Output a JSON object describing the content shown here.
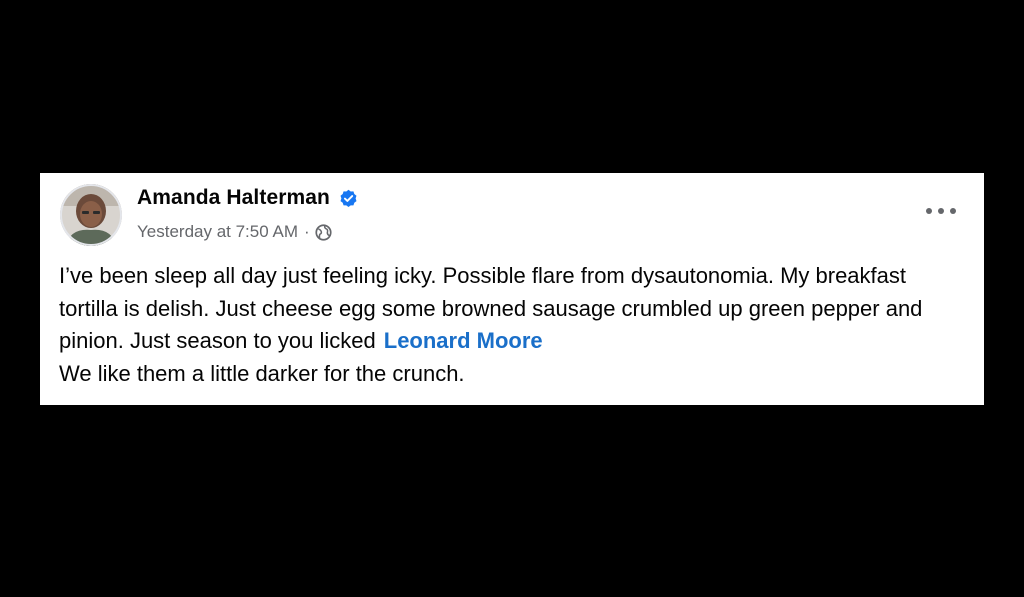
{
  "post": {
    "author": "Amanda Halterman",
    "timestamp": "Yesterday at 7:50 AM",
    "separator": "·",
    "audience_icon": "globe-icon",
    "verified_icon": "verified-badge-icon",
    "more_icon": "more-options-icon",
    "body": {
      "text_part1": "I’ve been sleep all day just feeling icky. Possible flare from dysautonomia. My breakfast tortilla is delish. Just cheese egg some browned sausage crumbled up green pepper and pinion. Just season to you licked",
      "mention": "Leonard Moore",
      "text_part2": "We like them a little darker for the crunch."
    }
  },
  "colors": {
    "background": "#000000",
    "card": "#ffffff",
    "text": "#050505",
    "secondary_text": "#65676b",
    "mention": "#1a6fc9",
    "verified": "#1877f2"
  }
}
